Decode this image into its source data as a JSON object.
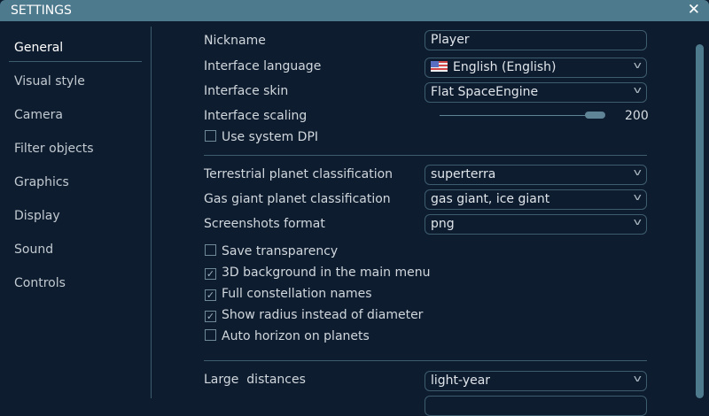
{
  "window": {
    "title": "SETTINGS",
    "close_icon": "close-icon"
  },
  "sidebar": {
    "items": [
      {
        "label": "General",
        "active": true
      },
      {
        "label": "Visual style"
      },
      {
        "label": "Camera"
      },
      {
        "label": "Filter objects"
      },
      {
        "label": "Graphics"
      },
      {
        "label": "Display"
      },
      {
        "label": "Sound"
      },
      {
        "label": "Controls"
      }
    ]
  },
  "general": {
    "nickname": {
      "label": "Nickname",
      "value": "Player"
    },
    "language": {
      "label": "Interface language",
      "value": "English (English)"
    },
    "skin": {
      "label": "Interface skin",
      "value": "Flat SpaceEngine"
    },
    "scaling": {
      "label": "Interface scaling",
      "value": "200",
      "fraction": 0.9
    },
    "system_dpi": {
      "label": "Use system DPI",
      "checked": false
    },
    "terrestrial": {
      "label": "Terrestrial planet classification",
      "value": "superterra"
    },
    "gas_giant": {
      "label": "Gas giant planet classification",
      "value": "gas giant, ice giant"
    },
    "screenshots": {
      "label": "Screenshots format",
      "value": "png"
    },
    "checkboxes": [
      {
        "label": "Save transparency",
        "checked": false
      },
      {
        "label": "3D background in the main menu",
        "checked": true
      },
      {
        "label": "Full constellation names",
        "checked": true
      },
      {
        "label": "Show radius instead of diameter",
        "checked": true
      },
      {
        "label": "Auto horizon on planets",
        "checked": false
      }
    ],
    "large_distances": {
      "label": "Large  distances",
      "value": "light-year"
    }
  },
  "check_glyph": "✓"
}
